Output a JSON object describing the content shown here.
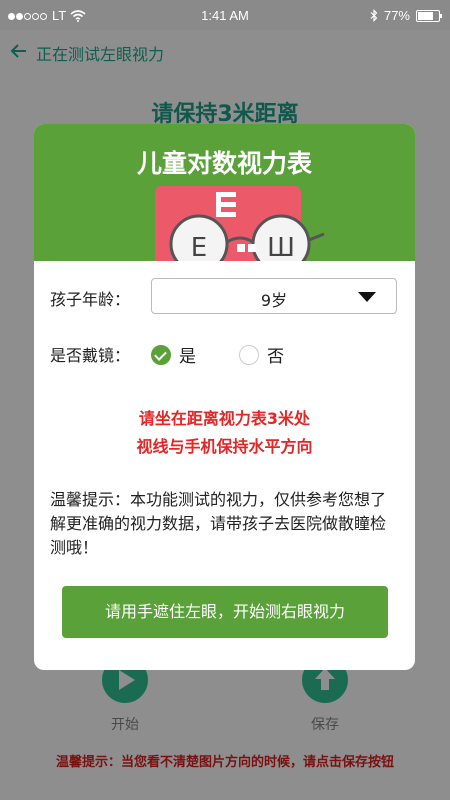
{
  "status_bar": {
    "carrier": "LT",
    "time": "1:41 AM",
    "battery": "77%",
    "battery_level": 0.77
  },
  "nav": {
    "title": "正在测试左眼视力",
    "back_icon": "arrow-left-icon"
  },
  "background": {
    "heading": "请保持3米距离",
    "start_label": "开始",
    "save_label": "保存",
    "bottom_tip": "温馨提示：当您看不清楚图片方向的时候，请点击保存按钮"
  },
  "modal": {
    "title": "儿童对数视力表",
    "age_label": "孩子年龄：",
    "age_value": "9岁",
    "glasses_label": "是否戴镜：",
    "glasses_yes": "是",
    "glasses_no": "否",
    "glasses_selected": "是",
    "red_line1": "请坐在距离视力表3米处",
    "red_line2": "视线与手机保持水平方向",
    "tip": "温馨提示：本功能测试的视力，仅供参考您想了解更准确的视力数据，请带孩子去医院做散瞳检测哦！",
    "action_label": "请用手遮住左眼，开始测右眼视力"
  },
  "colors": {
    "accent": "#5aa13a",
    "alert": "#e32626",
    "dark_green": "#1b6b52"
  }
}
